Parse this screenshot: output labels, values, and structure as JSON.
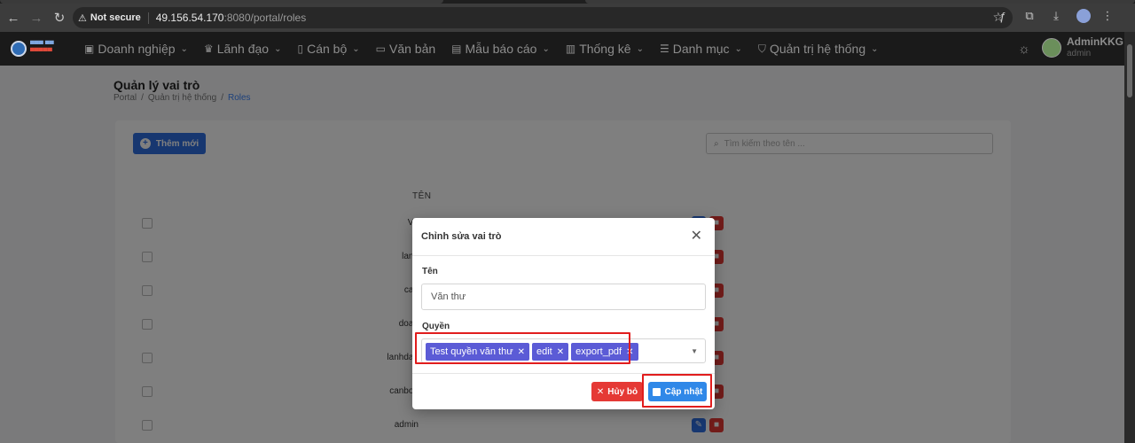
{
  "browser": {
    "security_label": "Not secure",
    "url_host": "49.156.54.170",
    "url_rest": ":8080/portal/roles"
  },
  "nav": {
    "menu": [
      {
        "label": "Doanh nghiệp",
        "icon": "briefcase-icon"
      },
      {
        "label": "Lãnh đạo",
        "icon": "crown-icon"
      },
      {
        "label": "Cán bộ",
        "icon": "id-card-icon"
      },
      {
        "label": "Văn bản",
        "icon": "document-icon"
      },
      {
        "label": "Mẫu báo cáo",
        "icon": "file-icon"
      },
      {
        "label": "Thống kê",
        "icon": "bar-chart-icon"
      },
      {
        "label": "Danh mục",
        "icon": "list-icon"
      },
      {
        "label": "Quản trị hệ thống",
        "icon": "shield-icon"
      }
    ],
    "user_name": "AdminKKG",
    "user_role": "admin"
  },
  "page": {
    "title": "Quản lý vai trò",
    "breadcrumb": [
      "Portal",
      "/",
      "Quản trị hệ thống",
      "/",
      "Roles"
    ],
    "add_label": "Thêm mới",
    "search_placeholder": "Tìm kiếm theo tên ...",
    "col_name": "TÊN",
    "rows": [
      "Vă",
      "lanh",
      "can",
      "doan",
      "lanhdao",
      "canbo_",
      "admin"
    ]
  },
  "modal": {
    "title": "Chỉnh sửa vai trò",
    "name_label": "Tên",
    "name_value": "Văn thư",
    "perm_label": "Quyền",
    "chips": [
      "Test quyền văn thư",
      "edit",
      "export_pdf"
    ],
    "cancel_label": "Hủy bỏ",
    "save_label": "Cập nhật"
  },
  "colors": {
    "primary": "#2f6fe0",
    "danger": "#e53935",
    "chip": "#5b5bd6",
    "highlight": "#e11d1d"
  }
}
